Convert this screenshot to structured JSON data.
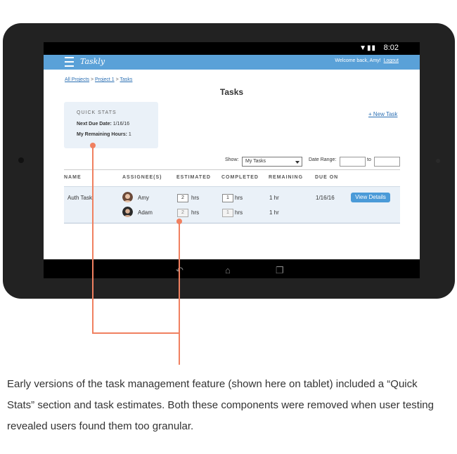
{
  "status": {
    "time": "8:02",
    "signal_icon": "wifi-signal-battery-icons"
  },
  "app": {
    "brand": "Taskly",
    "welcome": "Welcome back, Amy!",
    "logout": "Logout"
  },
  "breadcrumb": {
    "items": [
      "All Projects",
      "Project 1",
      "Tasks"
    ],
    "sep": ">"
  },
  "page": {
    "title": "Tasks"
  },
  "quick_stats": {
    "heading": "QUICK STATS",
    "next_due_label": "Next Due Date:",
    "next_due_value": "1/16/16",
    "remaining_label": "My Remaining Hours:",
    "remaining_value": "1"
  },
  "new_task": "+ New Task",
  "filters": {
    "show_label": "Show:",
    "show_value": "My Tasks",
    "date_range_label": "Date Range:",
    "to_label": "to"
  },
  "table": {
    "headers": [
      "NAME",
      "ASSIGNEE(S)",
      "ESTIMATED",
      "COMPLETED",
      "REMAINING",
      "DUE ON"
    ],
    "task": {
      "name": "Auth Task",
      "assignees": [
        {
          "name": "Amy",
          "estimated": "2",
          "est_unit": "hrs",
          "completed": "1",
          "comp_unit": "hrs",
          "remaining": "1 hr"
        },
        {
          "name": "Adam",
          "estimated": "2",
          "est_unit": "hrs",
          "completed": "1",
          "comp_unit": "hrs",
          "remaining": "1 hr"
        }
      ],
      "due_on": "1/16/16",
      "action": "View Details"
    }
  },
  "caption": "Early versions of the task management feature (shown here on tablet) included a “Quick Stats” section and task estimates. Both these components were removed when user testing revealed users found them too granular.",
  "colors": {
    "appbar": "#5aa1d8",
    "accent": "#f08060",
    "panel": "#eaf1f8",
    "button": "#4a9ad8"
  }
}
